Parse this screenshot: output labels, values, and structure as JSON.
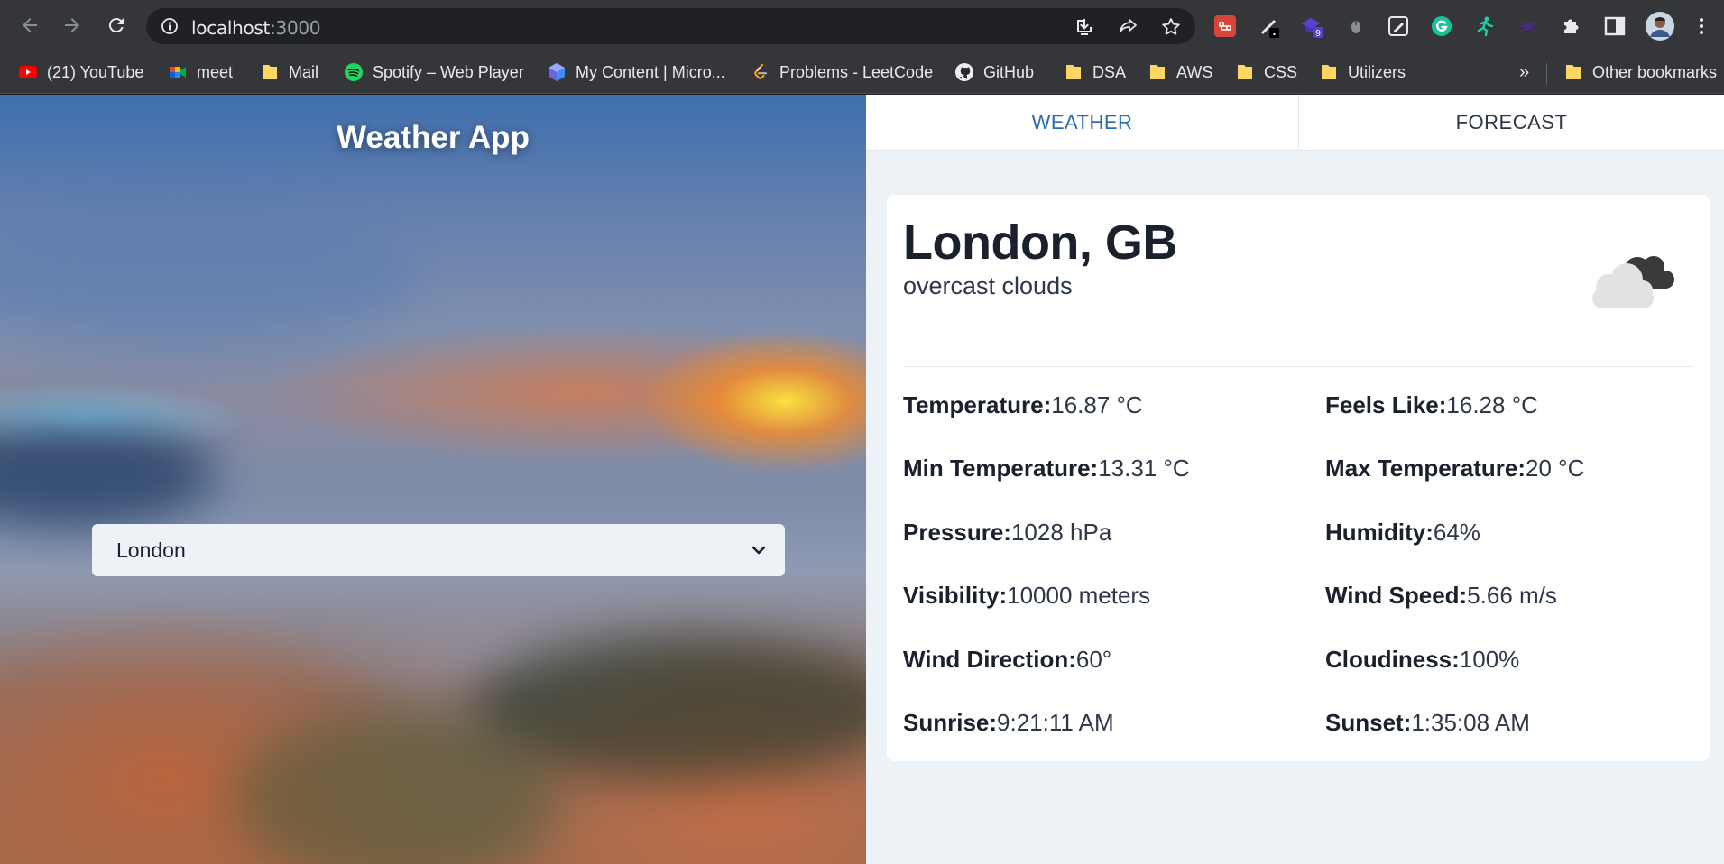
{
  "browser": {
    "url_host": "localhost",
    "url_port": ":3000",
    "bookmarks": [
      {
        "label": "(21) YouTube",
        "icon": "youtube-icon"
      },
      {
        "label": "meet",
        "icon": "meet-icon"
      },
      {
        "label": "Mail",
        "icon": "folder-icon"
      },
      {
        "label": "Spotify – Web Player",
        "icon": "spotify-icon"
      },
      {
        "label": "My Content | Micro...",
        "icon": "microsoft-icon"
      },
      {
        "label": "Problems - LeetCode",
        "icon": "leetcode-icon"
      },
      {
        "label": "GitHub",
        "icon": "github-icon"
      },
      {
        "label": "DSA",
        "icon": "folder-icon"
      },
      {
        "label": "AWS",
        "icon": "folder-icon"
      },
      {
        "label": "CSS",
        "icon": "folder-icon"
      },
      {
        "label": "Utilizers",
        "icon": "folder-icon"
      }
    ],
    "overflow_label": "»",
    "other_bookmarks": "Other bookmarks",
    "extension_badge": "9"
  },
  "app": {
    "title": "Weather App",
    "selected_city": "London"
  },
  "tabs": [
    {
      "label": "WEATHER",
      "active": true
    },
    {
      "label": "FORECAST",
      "active": false
    }
  ],
  "weather": {
    "location": "London, GB",
    "description": "overcast clouds",
    "icon": "overcast-clouds-icon",
    "stats": [
      {
        "label": "Temperature:",
        "value": "16.87 °C"
      },
      {
        "label": "Feels Like:",
        "value": "16.28 °C"
      },
      {
        "label": "Min Temperature:",
        "value": "13.31 °C"
      },
      {
        "label": "Max Temperature:",
        "value": "20 °C"
      },
      {
        "label": "Pressure:",
        "value": "1028 hPa"
      },
      {
        "label": "Humidity:",
        "value": "64%"
      },
      {
        "label": "Visibility:",
        "value": "10000 meters"
      },
      {
        "label": "Wind Speed:",
        "value": "5.66 m/s"
      },
      {
        "label": "Wind Direction:",
        "value": "60°"
      },
      {
        "label": "Cloudiness:",
        "value": "100%"
      },
      {
        "label": "Sunrise:",
        "value": "9:21:11 AM"
      },
      {
        "label": "Sunset:",
        "value": "1:35:08 AM"
      }
    ]
  },
  "colors": {
    "accent": "#2b6cb0",
    "panel_bg": "#edf2f7",
    "text_dark": "#1a202c"
  }
}
